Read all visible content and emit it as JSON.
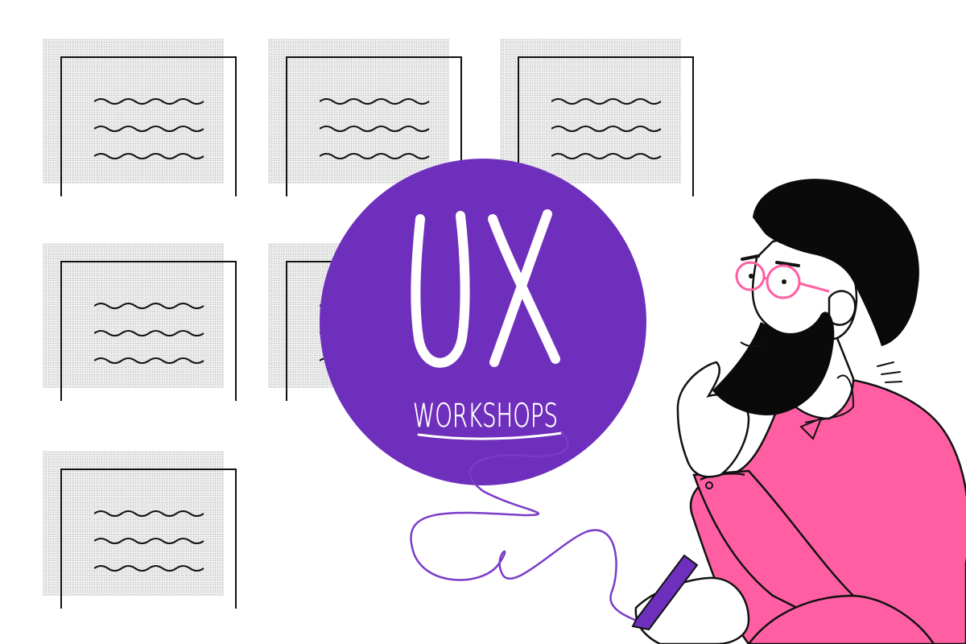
{
  "badge": {
    "title": "UX",
    "subtitle": "WORKSHOPS",
    "color": "#6f2fbd",
    "text_color": "#ffffff"
  },
  "illustration": {
    "shirt_color": "#ff5fa2",
    "glasses_color": "#ff5fa2",
    "pen_color": "#6f2fbd",
    "hair_color": "#0a0a0a"
  },
  "icons": [
    "document-icon",
    "doodle-line",
    "person-illustration"
  ]
}
